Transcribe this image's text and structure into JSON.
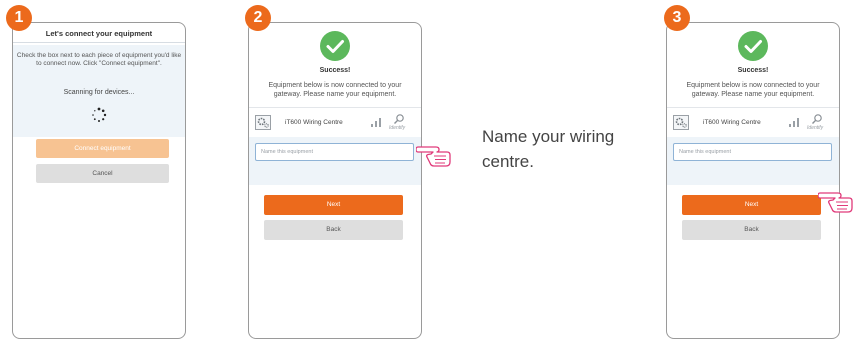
{
  "steps": [
    {
      "number": "1"
    },
    {
      "number": "2"
    },
    {
      "number": "3"
    }
  ],
  "step1": {
    "title": "Let's connect your equipment",
    "description": "Check the box next to each piece of equipment you'd like to connect now. Click \"Connect equipment\".",
    "scanning": "Scanning for devices...",
    "connect_label": "Connect equipment",
    "cancel_label": "Cancel"
  },
  "step2": {
    "success_title": "Success!",
    "success_message": "Equipment below is now connected to your gateway. Please name your equipment.",
    "device_name": "iT600 Wiring Centre",
    "identify_label": "Identify",
    "input_placeholder": "Name this equipment",
    "next_label": "Next",
    "back_label": "Back"
  },
  "step3": {
    "success_title": "Success!",
    "success_message": "Equipment below is now connected to your gateway. Please name your equipment.",
    "device_name": "iT600 Wiring Centre",
    "identify_label": "Identify",
    "input_placeholder": "Name this equipment",
    "next_label": "Next",
    "back_label": "Back"
  },
  "instruction": "Name your wiring centre.",
  "colors": {
    "accent": "#ec6a1c",
    "success": "#5cb85c",
    "panel": "#eef4f9",
    "button_grey": "#dedede"
  },
  "icons": [
    "spinner-icon",
    "check-icon",
    "gear-icon",
    "signal-icon",
    "identify-icon",
    "pointing-hand-icon"
  ]
}
